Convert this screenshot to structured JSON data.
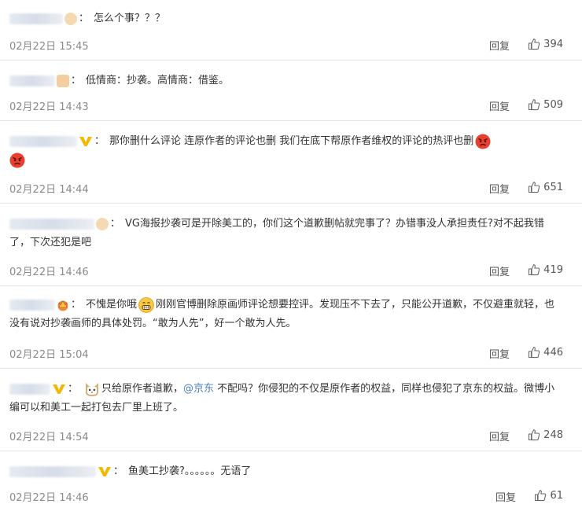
{
  "comments": [
    {
      "separator": "：",
      "text": "怎么个事？？？",
      "time": "02月22日 15:45",
      "reply_label": "回复",
      "likes": "394"
    },
    {
      "separator": "：",
      "text": "低情商：抄袭。高情商：借鉴。",
      "time": "02月22日 14:43",
      "reply_label": "回复",
      "likes": "509"
    },
    {
      "separator": "：",
      "text": "那你删什么评论 连原作者的评论也删 我们在底下帮原作者维权的评论的热评也删",
      "time": "02月22日 14:44",
      "reply_label": "回复",
      "likes": "651"
    },
    {
      "separator": "：",
      "text": "VG海报抄袭可是开除美工的，你们这个道歉删帖就完事了？办错事没人承担责任?对不起我错了，下次还犯是吧",
      "time": "02月22日 14:46",
      "reply_label": "回复",
      "likes": "419"
    },
    {
      "separator": "：",
      "text_a": "不愧是你哦",
      "text_b": "刚刚官博删除原画师评论想要控评。发现压不下去了，只能公开道歉，不仅避重就轻，也没有说对抄袭画师的具体处罚。“敢为人先”，好一个敢为人先。",
      "time": "02月22日 15:04",
      "reply_label": "回复",
      "likes": "446"
    },
    {
      "separator": "：",
      "text_a": "只给原作者道歉，",
      "mention": "@京东",
      "text_b": " 不配吗？你侵犯的不仅是原作者的权益，同样也侵犯了京东的权益。微博小编可以和美工一起打包去厂里上班了。",
      "time": "02月22日 14:54",
      "reply_label": "回复",
      "likes": "248"
    },
    {
      "separator": "：",
      "text": "鱼美工抄袭?。。。。。。无语了",
      "time": "02月22日 14:46",
      "reply_label": "回复",
      "likes": "61"
    }
  ],
  "icons": {
    "like": "thumbs-up-icon",
    "angry": "angry-face-emoji",
    "grin": "grinning-face-emoji",
    "cat": "cat-face-emoji",
    "verified": "verified-v-icon"
  },
  "colors": {
    "mention": "#4c7fb8",
    "verified": "#f5b800",
    "meta": "#8a8a8a"
  }
}
